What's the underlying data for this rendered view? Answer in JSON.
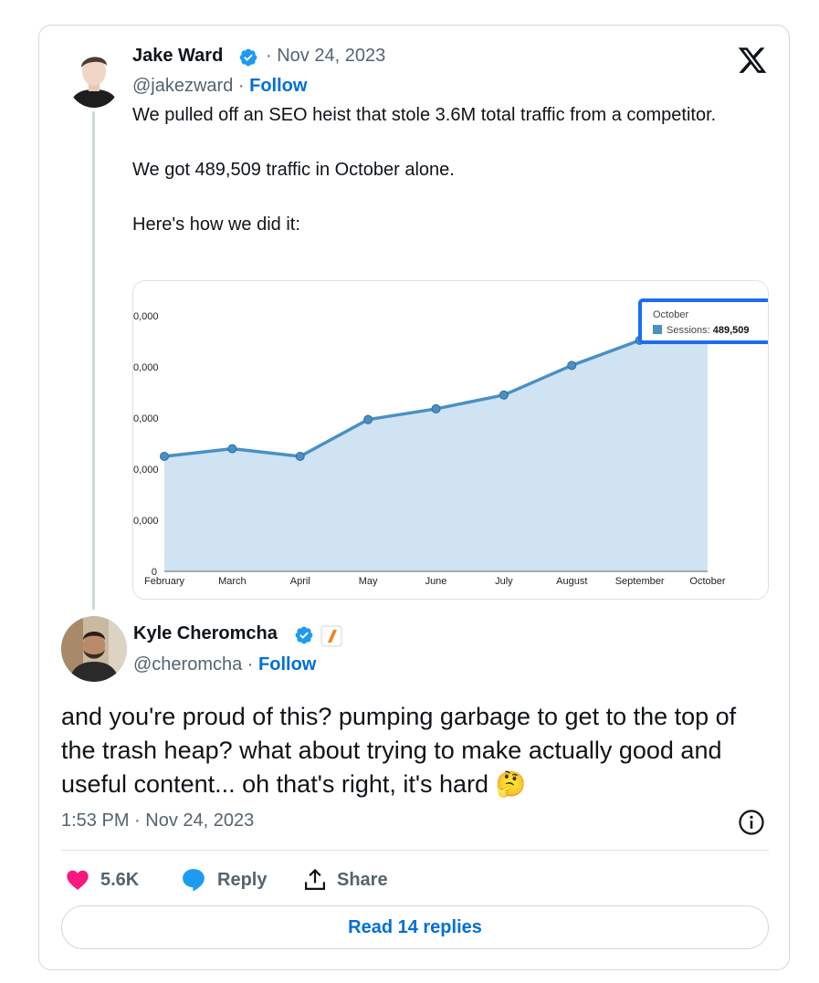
{
  "tweet": {
    "author_name": "Jake Ward",
    "date": "Nov 24, 2023",
    "handle": "@jakezward",
    "follow_label": "Follow",
    "text_lines": [
      "We pulled off an SEO heist that stole 3.6M total traffic from a competitor.",
      "We got 489,509 traffic in October alone.",
      "Here's how we did it:"
    ],
    "platform_logo": "x-logo-icon"
  },
  "chart_data": {
    "type": "area",
    "categories": [
      "February",
      "March",
      "April",
      "May",
      "June",
      "July",
      "August",
      "September",
      "October"
    ],
    "series": [
      {
        "values": [
          225000,
          240000,
          225000,
          297000,
          318000,
          345000,
          403000,
          452000,
          489509
        ]
      }
    ],
    "y_tick_labels": [
      "0",
      "0,000",
      "0,000",
      "0,000",
      "0,000",
      "0,000"
    ],
    "ylim": [
      0,
      500000
    ],
    "tooltip": {
      "title": "October",
      "label": "Sessions:",
      "value": "489,509"
    },
    "colors": {
      "line": "#4a90c4",
      "fill": "#d0e3f3",
      "tooltip_border": "#1d6cf2"
    }
  },
  "reply": {
    "author_name": "Kyle Cheromcha",
    "handle": "@cheromcha",
    "follow_label": "Follow",
    "text": "and you're proud of this? pumping garbage to get to the top of the trash heap? what about trying to make actually good and useful content... oh that's right, it's hard",
    "emoji": "🤔",
    "timestamp": "1:53 PM · Nov 24, 2023"
  },
  "actions": {
    "like_count": "5.6K",
    "reply_label": "Reply",
    "share_label": "Share",
    "read_replies_label": "Read 14 replies"
  },
  "colors": {
    "accent": "#006fd6",
    "like": "#f91880",
    "verified": "#1d9bf0",
    "muted": "#536471"
  }
}
